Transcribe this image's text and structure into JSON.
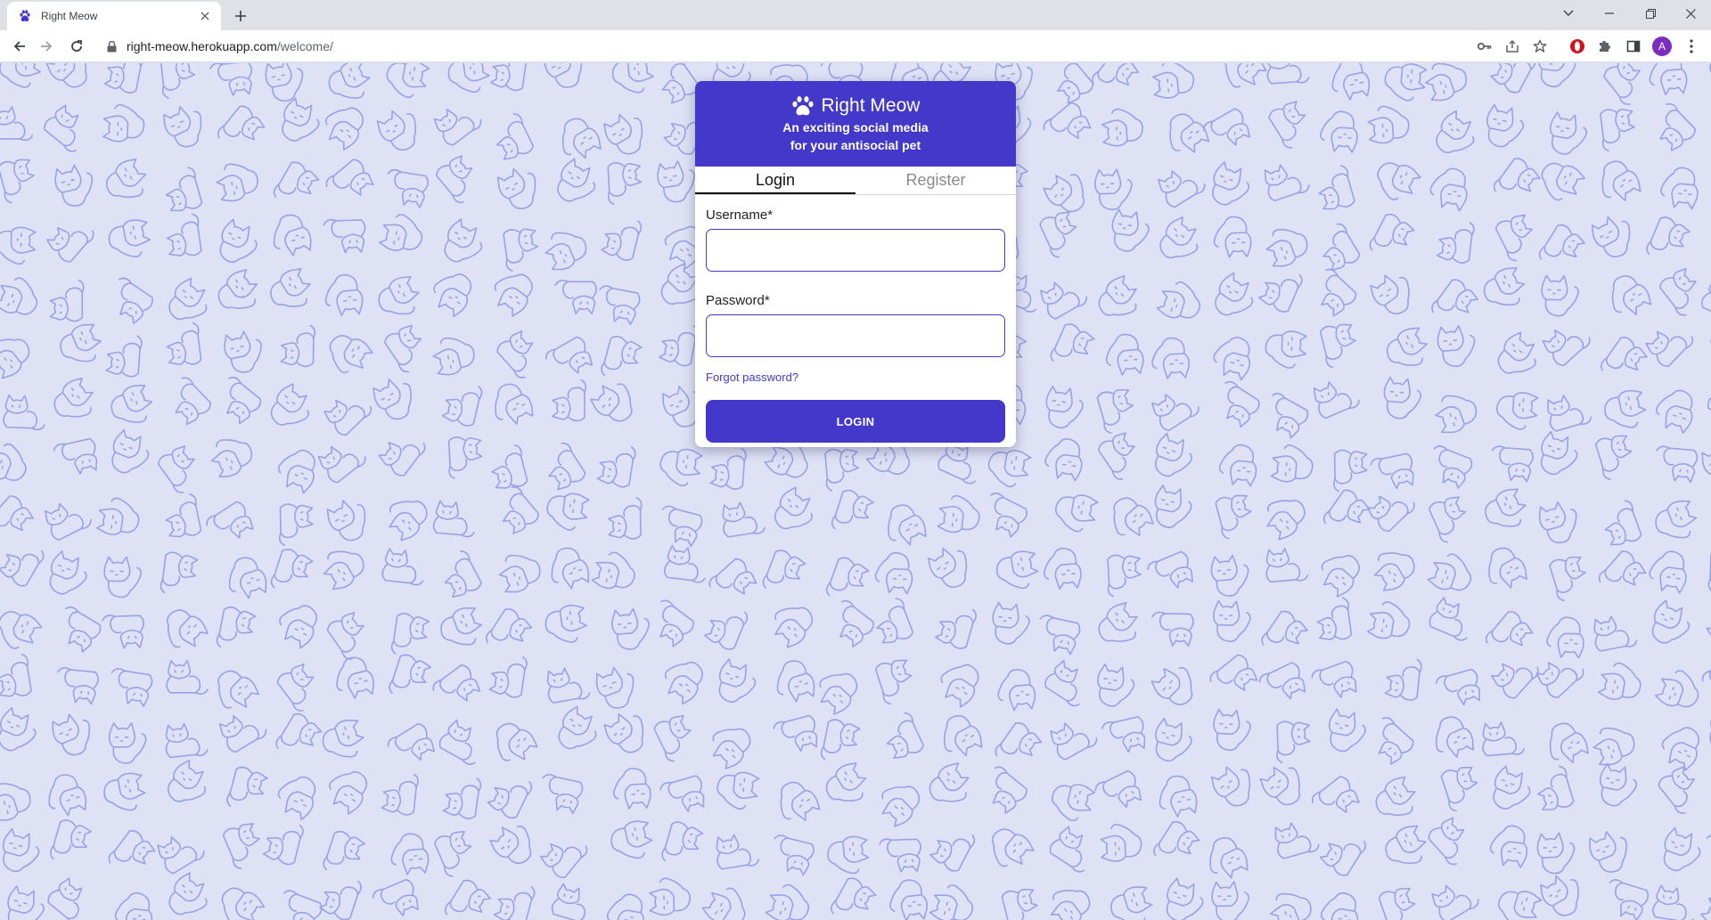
{
  "browser": {
    "tab_title": "Right Meow",
    "url_host": "right-meow.herokuapp.com",
    "url_path": "/welcome/",
    "avatar_letter": "A"
  },
  "app": {
    "name": "Right Meow",
    "tagline_line1": "An exciting social media",
    "tagline_line2": "for your antisocial pet",
    "brand_color": "#4338ca",
    "background_color": "#dfe1f5",
    "pattern_color": "#9aa2e6"
  },
  "auth": {
    "tabs": [
      {
        "label": "Login",
        "active": true
      },
      {
        "label": "Register",
        "active": false
      }
    ],
    "username_label": "Username*",
    "password_label": "Password*",
    "username_value": "",
    "password_value": "",
    "forgot_label": "Forgot password?",
    "submit_label": "LOGIN"
  }
}
